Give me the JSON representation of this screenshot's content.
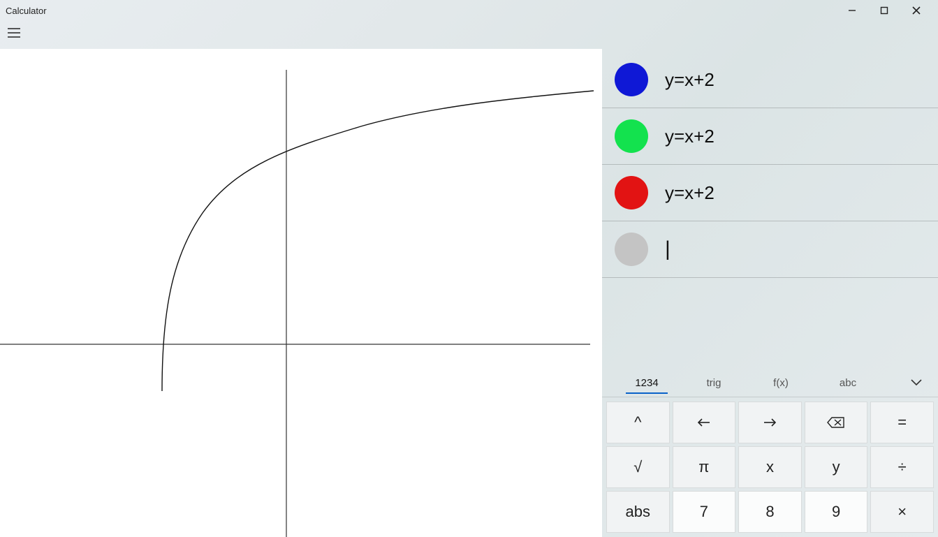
{
  "window": {
    "title": "Calculator"
  },
  "equations": [
    {
      "color": "#0f18d6",
      "label": "y=x+2"
    },
    {
      "color": "#13e24e",
      "label": "y=x+2"
    },
    {
      "color": "#e21313",
      "label": "y=x+2"
    }
  ],
  "new_equation": {
    "color": "#c4c4c4",
    "cursor": "|"
  },
  "keypad_tabs": {
    "numbers": "1234",
    "trig": "trig",
    "fx": "f(x)",
    "abc": "abc"
  },
  "keys": {
    "caret": "^",
    "equals": "=",
    "sqrt": "√",
    "pi": "π",
    "x": "x",
    "y": "y",
    "divide": "÷",
    "abs": "abs",
    "k7": "7",
    "k8": "8",
    "k9": "9",
    "times": "×"
  }
}
